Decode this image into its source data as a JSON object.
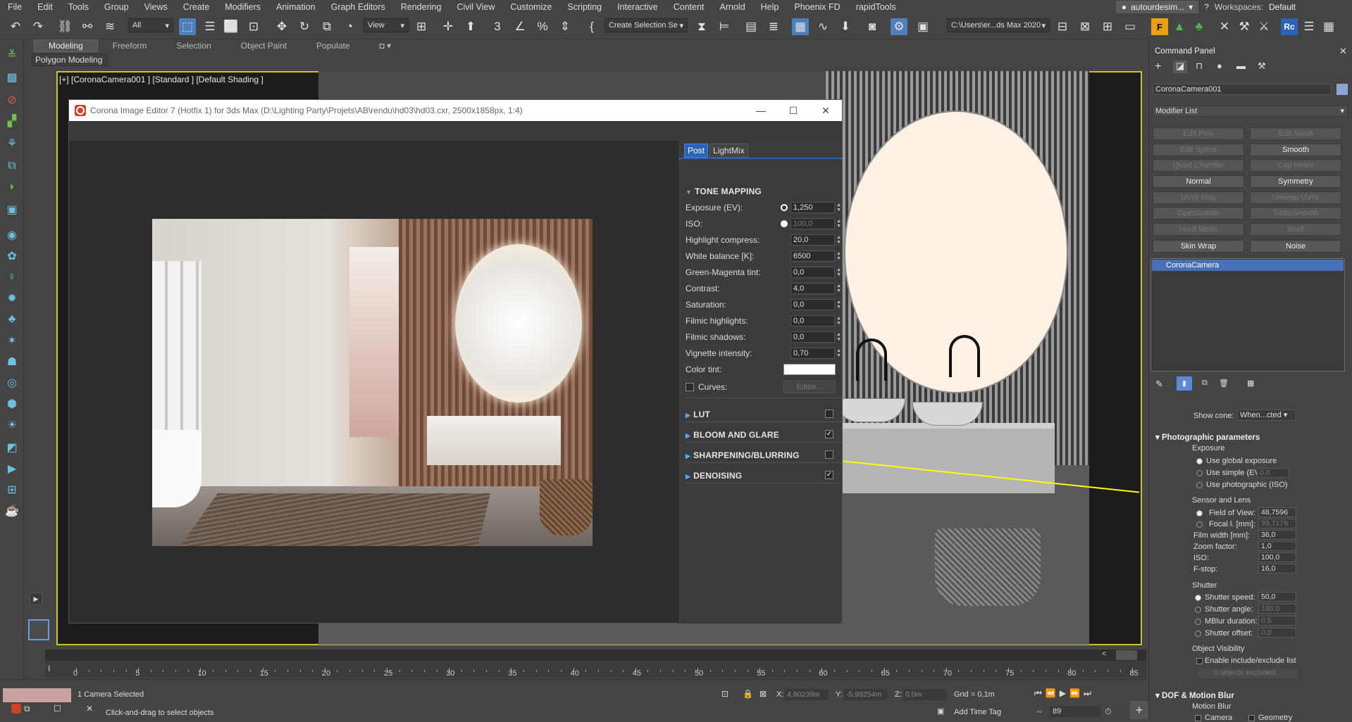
{
  "menubar": {
    "items": [
      "File",
      "Edit",
      "Tools",
      "Group",
      "Views",
      "Create",
      "Modifiers",
      "Animation",
      "Graph Editors",
      "Rendering",
      "Civil View",
      "Customize",
      "Scripting",
      "Interactive",
      "Content",
      "Arnold",
      "Help",
      "Phoenix FD",
      "rapidTools"
    ],
    "user": "autourdesim...",
    "workspaces_label": "Workspaces:",
    "workspace": "Default"
  },
  "toolbar": {
    "filter": "All",
    "ref_coord": "View",
    "selection_set": "Create Selection Se",
    "path": "C:\\Users\\er...ds Max 2020"
  },
  "ribbon": {
    "tabs": [
      "Modeling",
      "Freeform",
      "Selection",
      "Object Paint",
      "Populate"
    ],
    "polygon_modeling": "Polygon Modeling"
  },
  "viewport": {
    "label": "[+] [CoronaCamera001 ] [Standard ] [Default Shading ]"
  },
  "cie": {
    "title": "Corona Image Editor 7 (Hotfix 1) for 3ds Max (D:\\Lighting Party\\Projets\\AB\\rendu\\hd03\\hd03.cxr, 2500x1858px, 1:4)",
    "tabs": [
      "Post",
      "LightMix"
    ],
    "tone_mapping": "TONE MAPPING",
    "params": [
      {
        "label": "Exposure (EV):",
        "value": "1,250"
      },
      {
        "label": "ISO:",
        "value": "100,0"
      },
      {
        "label": "Highlight compress:",
        "value": "20,0"
      },
      {
        "label": "White balance [K]:",
        "value": "6500"
      },
      {
        "label": "Green-Magenta tint:",
        "value": "0,0"
      },
      {
        "label": "Contrast:",
        "value": "4,0"
      },
      {
        "label": "Saturation:",
        "value": "0,0"
      },
      {
        "label": "Filmic highlights:",
        "value": "0,0"
      },
      {
        "label": "Filmic shadows:",
        "value": "0,0"
      },
      {
        "label": "Vignette intensity:",
        "value": "0,70"
      }
    ],
    "color_tint": "Color tint:",
    "curves": "Curves:",
    "editor": "Editor...",
    "sections": [
      "LUT",
      "BLOOM AND GLARE",
      "SHARPENING/BLURRING",
      "DENOISING"
    ],
    "section_checked": [
      false,
      true,
      false,
      true
    ]
  },
  "command_panel": {
    "title": "Command Panel",
    "object_name": "CoronaCamera001",
    "modifier_list": "Modifier List",
    "modifiers": [
      "Edit Poly",
      "Edit Mesh",
      "Edit Spline",
      "Smooth",
      "Quad Chamfer",
      "Cap Holes",
      "Normal",
      "Symmetry",
      "UVW Map",
      "Unwrap UVW",
      "OpenSubdiv",
      "TurboSmooth",
      "Hard Mesh",
      "Shell",
      "Skin Wrap",
      "Noise"
    ],
    "modifiers_enabled": [
      false,
      false,
      false,
      true,
      false,
      false,
      true,
      true,
      false,
      false,
      false,
      false,
      false,
      false,
      true,
      true
    ],
    "stack_item": "CoronaCamera",
    "show_cone_label": "Show cone:",
    "show_cone_value": "When...cted",
    "photo_params": "Photographic parameters",
    "exposure": "Exposure",
    "use_global": "Use global exposure",
    "use_simple": "Use simple (EV)",
    "simple_val": "0,0",
    "use_photo": "Use photographic (ISO)",
    "sensor_lens": "Sensor and Lens",
    "fov_label": "Field of View:",
    "fov": "48,7596",
    "focal_label": "Focal l. [mm]:",
    "focal": "39,7179",
    "film_label": "Film width [mm]:",
    "film": "36,0",
    "zoom_label": "Zoom factor:",
    "zoom": "1,0",
    "iso_label": "ISO:",
    "iso": "100,0",
    "fstop_label": "F-stop:",
    "fstop": "16,0",
    "shutter": "Shutter",
    "shutter_speed_label": "Shutter speed:",
    "shutter_speed": "50,0",
    "shutter_angle_label": "Shutter angle:",
    "shutter_angle": "180,0",
    "mblur_label": "MBlur duration:",
    "mblur": "0,5",
    "shutter_offset_label": "Shutter offset:",
    "shutter_offset": "0,0",
    "object_visibility": "Object Visibility",
    "enable_include": "Enable include/exclude list",
    "objects_excluded": "0 objects excluded...",
    "dof": "DOF & Motion Blur",
    "motion_blur": "Motion Blur",
    "camera": "Camera",
    "geometry": "Geometry"
  },
  "timeline": {
    "ticks": [
      "0",
      "5",
      "10",
      "15",
      "20",
      "25",
      "30",
      "35",
      "40",
      "45",
      "50",
      "55",
      "60",
      "65",
      "70",
      "75",
      "80",
      "85"
    ]
  },
  "status": {
    "selected": "1 Camera Selected",
    "hint": "Click-and-drag to select objects",
    "x_label": "X:",
    "x": "4,90239m",
    "y_label": "Y:",
    "y": "-5,99254m",
    "z_label": "Z:",
    "z": "0,0m",
    "grid": "Grid = 0,1m",
    "add_time_tag": "Add Time Tag",
    "frame": "89"
  }
}
